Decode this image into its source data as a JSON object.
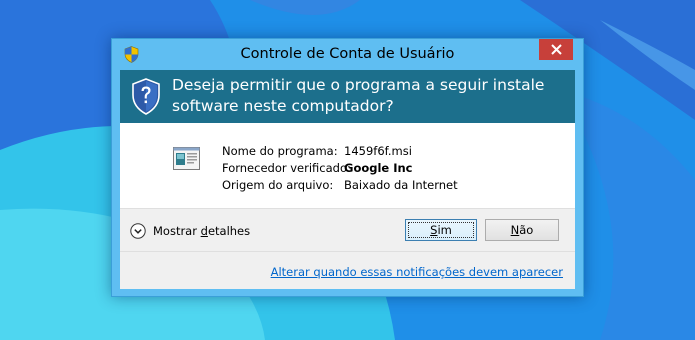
{
  "window": {
    "title": "Controle de Conta de Usuário"
  },
  "header": {
    "question": "Deseja permitir que o programa a seguir instale software neste computador?"
  },
  "details": {
    "rows": [
      {
        "label": "Nome do programa:",
        "value": "1459f6f.msi"
      },
      {
        "label": "Fornecedor verificado:",
        "value": "Google Inc"
      },
      {
        "label": "Origem do arquivo:",
        "value": "Baixado da Internet"
      }
    ]
  },
  "footer": {
    "show_details": {
      "before": "Mostrar ",
      "accel": "d",
      "after": "etalhes"
    },
    "yes_button": {
      "accel": "S",
      "after": "im"
    },
    "no_button": {
      "accel": "N",
      "after": "ão"
    },
    "notify_link": "Alterar quando essas notificações devem aparecer"
  },
  "colors": {
    "desktop": "#1f8fe8",
    "window_frame": "#5fbef2",
    "header_band": "#1c6f8c",
    "close_button": "#c7403a",
    "link": "#0066cc"
  },
  "icons": {
    "title": "uac-shield-icon",
    "header": "uac-question-shield-icon",
    "program": "msi-program-icon",
    "details_toggle": "chevron-down-circle-icon",
    "close": "close-icon"
  }
}
